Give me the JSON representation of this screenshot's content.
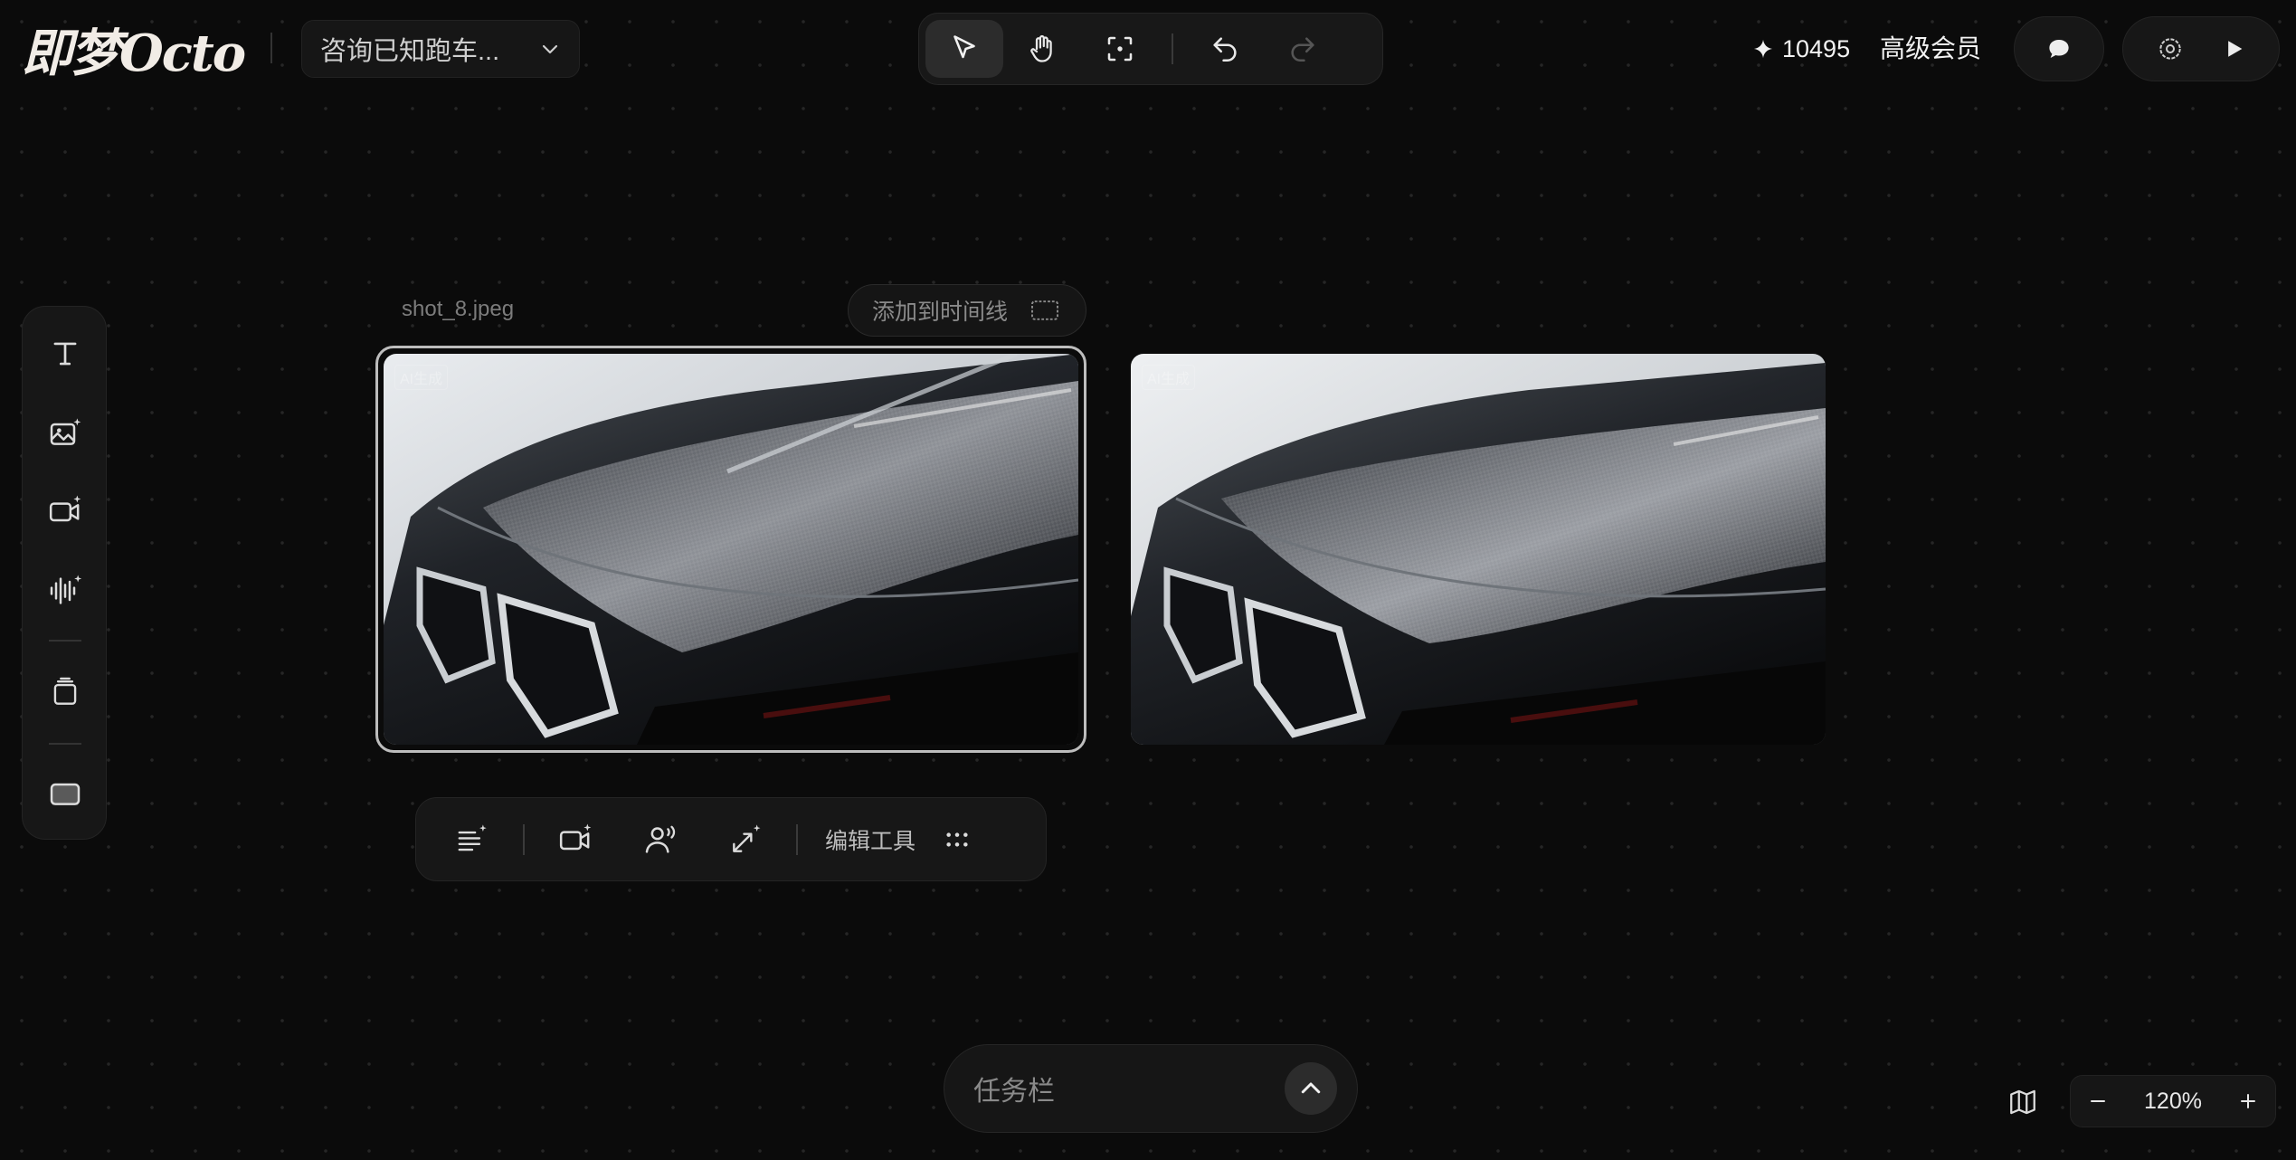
{
  "header": {
    "logo_text": "即梦Octo",
    "project_title": "咨询已知跑车...",
    "credits": "10495",
    "membership": "高级会员"
  },
  "toolbar": {
    "tools": [
      "pointer-icon",
      "hand-icon",
      "focus-frame-icon",
      "undo-icon",
      "redo-icon"
    ],
    "active_tool": "pointer"
  },
  "left_tools": [
    "text-tool-icon",
    "image-ai-icon",
    "video-ai-icon",
    "audio-ai-icon",
    "layers-icon",
    "frame-icon"
  ],
  "canvas": {
    "selected_file": "shot_8.jpeg",
    "add_to_timeline": "添加到时间线",
    "images": [
      {
        "ai_tag": "AI生成"
      },
      {
        "ai_tag": "AI生成"
      }
    ]
  },
  "image_toolbar": {
    "edit_tools_label": "编辑工具"
  },
  "taskbar": {
    "label": "任务栏"
  },
  "zoom": {
    "level": "120%"
  },
  "colors": {
    "background": "#0b0b0b",
    "panel": "#171717",
    "selection": "#bdbdbd"
  }
}
